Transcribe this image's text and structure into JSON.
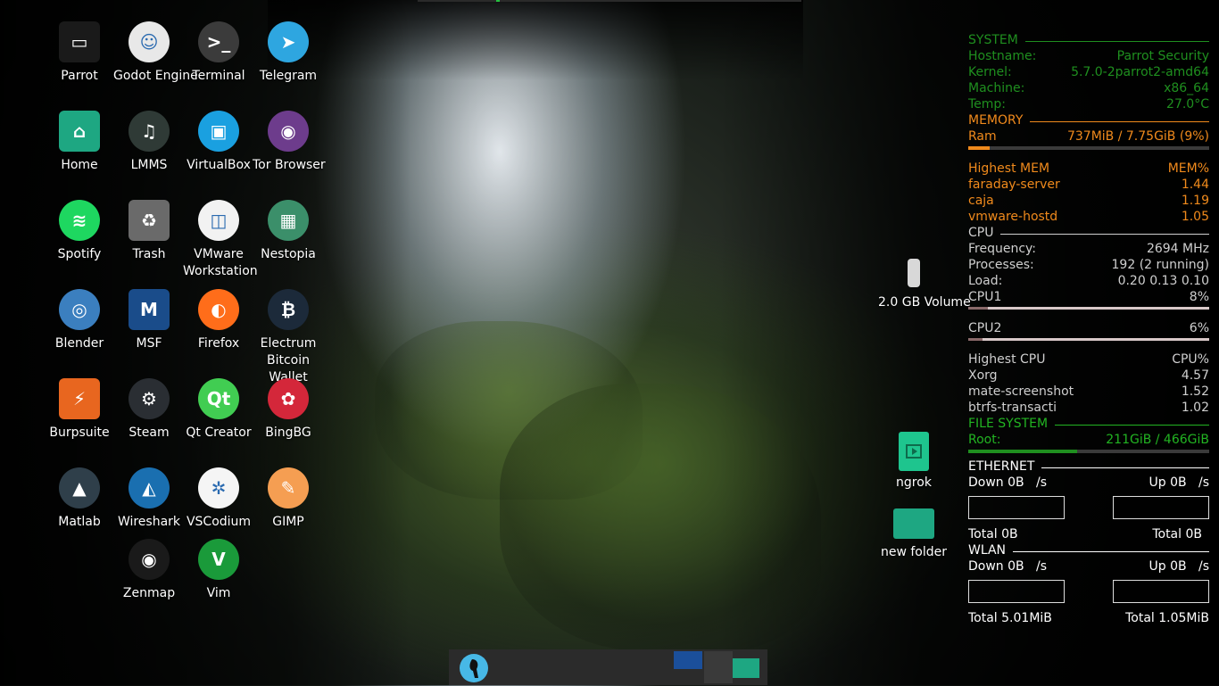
{
  "desktop_icons": [
    {
      "label": "Parrot",
      "icon": "monitor-icon",
      "color": "#1a1a1a"
    },
    {
      "label": "Godot Engine",
      "icon": "godot-icon",
      "color": "#e8e8e8"
    },
    {
      "label": "Terminal",
      "icon": "terminal-icon",
      "color": "#3b3b3b"
    },
    {
      "label": "Telegram",
      "icon": "telegram-icon",
      "color": "#2ea6e0"
    },
    {
      "label": "Home",
      "icon": "home-folder-icon",
      "color": "#1ea782"
    },
    {
      "label": "LMMS",
      "icon": "lmms-icon",
      "color": "#2f3a36"
    },
    {
      "label": "VirtualBox",
      "icon": "virtualbox-icon",
      "color": "#1aa0e0"
    },
    {
      "label": "Tor Browser",
      "icon": "tor-browser-icon",
      "color": "#6d3c8c"
    },
    {
      "label": "Spotify",
      "icon": "spotify-icon",
      "color": "#1ed760"
    },
    {
      "label": "Trash",
      "icon": "trash-icon",
      "color": "#6a6a6a"
    },
    {
      "label": "VMware Workstation",
      "icon": "vmware-icon",
      "color": "#f2f2f2"
    },
    {
      "label": "Nestopia",
      "icon": "nestopia-icon",
      "color": "#3b8f6a"
    },
    {
      "label": "Blender",
      "icon": "blender-icon",
      "color": "#3b7fbf"
    },
    {
      "label": "MSF",
      "icon": "metasploit-icon",
      "color": "#1a4c8a"
    },
    {
      "label": "Firefox",
      "icon": "firefox-icon",
      "color": "#ff6d1a"
    },
    {
      "label": "Electrum Bitcoin Wallet",
      "icon": "electrum-icon",
      "color": "#1c2a3a"
    },
    {
      "label": "Burpsuite",
      "icon": "burpsuite-icon",
      "color": "#e8661f"
    },
    {
      "label": "Steam",
      "icon": "steam-icon",
      "color": "#2a2e33"
    },
    {
      "label": "Qt Creator",
      "icon": "qt-creator-icon",
      "color": "#41cd52"
    },
    {
      "label": "BingBG",
      "icon": "bingbg-icon",
      "color": "#d4273a"
    },
    {
      "label": "Matlab",
      "icon": "matlab-icon",
      "color": "#2f3f4a"
    },
    {
      "label": "Wireshark",
      "icon": "wireshark-icon",
      "color": "#1a6fb0"
    },
    {
      "label": "VSCodium",
      "icon": "vscodium-icon",
      "color": "#f5f5f5"
    },
    {
      "label": "GIMP",
      "icon": "gimp-icon",
      "color": "#f59e52"
    },
    {
      "label": "Zenmap",
      "icon": "zenmap-icon",
      "color": "#1a1a1a"
    },
    {
      "label": "Vim",
      "icon": "vim-icon",
      "color": "#1a9a3a"
    }
  ],
  "right_icons": [
    {
      "label": "2.0 GB Volume",
      "icon": "usb-drive-icon"
    },
    {
      "label": "ngrok",
      "icon": "video-file-icon"
    },
    {
      "label": "new folder",
      "icon": "folder-icon"
    }
  ],
  "conky": {
    "system": {
      "header": "SYSTEM",
      "hostname_label": "Hostname:",
      "hostname": "Parrot Security",
      "kernel_label": "Kernel:",
      "kernel": "5.7.0-2parrot2-amd64",
      "machine_label": "Machine:",
      "machine": "x86_64",
      "temp_label": "Temp:",
      "temp": "27.0°C"
    },
    "memory": {
      "header": "MEMORY",
      "ram_label": "Ram",
      "ram": "737MiB / 7.75GiB (9%)",
      "ram_fraction": 0.09,
      "top_header": "Highest MEM",
      "top_col": "MEM%",
      "top": [
        {
          "name": "faraday-server",
          "value": "1.44"
        },
        {
          "name": "caja",
          "value": "1.19"
        },
        {
          "name": "vmware-hostd",
          "value": "1.05"
        }
      ]
    },
    "cpu": {
      "header": "CPU",
      "freq_label": "Frequency:",
      "freq": "2694 MHz",
      "proc_label": "Processes:",
      "proc": "192 (2 running)",
      "load_label": "Load:",
      "load": "0.20 0.13 0.10",
      "cpu1_label": "CPU1",
      "cpu1": "8%",
      "cpu1_fraction": 0.08,
      "cpu2_label": "CPU2",
      "cpu2": "6%",
      "cpu2_fraction": 0.06,
      "top_header": "Highest CPU",
      "top_col": "CPU%",
      "top": [
        {
          "name": "Xorg",
          "value": "4.57"
        },
        {
          "name": "mate-screenshot",
          "value": "1.52"
        },
        {
          "name": "btrfs-transacti",
          "value": "1.02"
        }
      ]
    },
    "filesystem": {
      "header": "FILE SYSTEM",
      "root_label": "Root:",
      "root": "211GiB / 466GiB",
      "root_fraction": 0.45
    },
    "ethernet": {
      "header": "ETHERNET",
      "down": "Down 0B   /s",
      "up": "Up 0B   /s",
      "total_down": "Total 0B",
      "total_up": "Total 0B"
    },
    "wlan": {
      "header": "WLAN",
      "down": "Down 0B   /s",
      "up": "Up 0B   /s",
      "total_down": "Total 5.01MiB",
      "total_up": "Total 1.05MiB"
    }
  },
  "colors": {
    "green": "#1f8f1f",
    "orange": "#f08a1c",
    "accent_teal": "#1ea782"
  },
  "taskbar": {
    "menu_icon": "parrot-menu-icon"
  }
}
